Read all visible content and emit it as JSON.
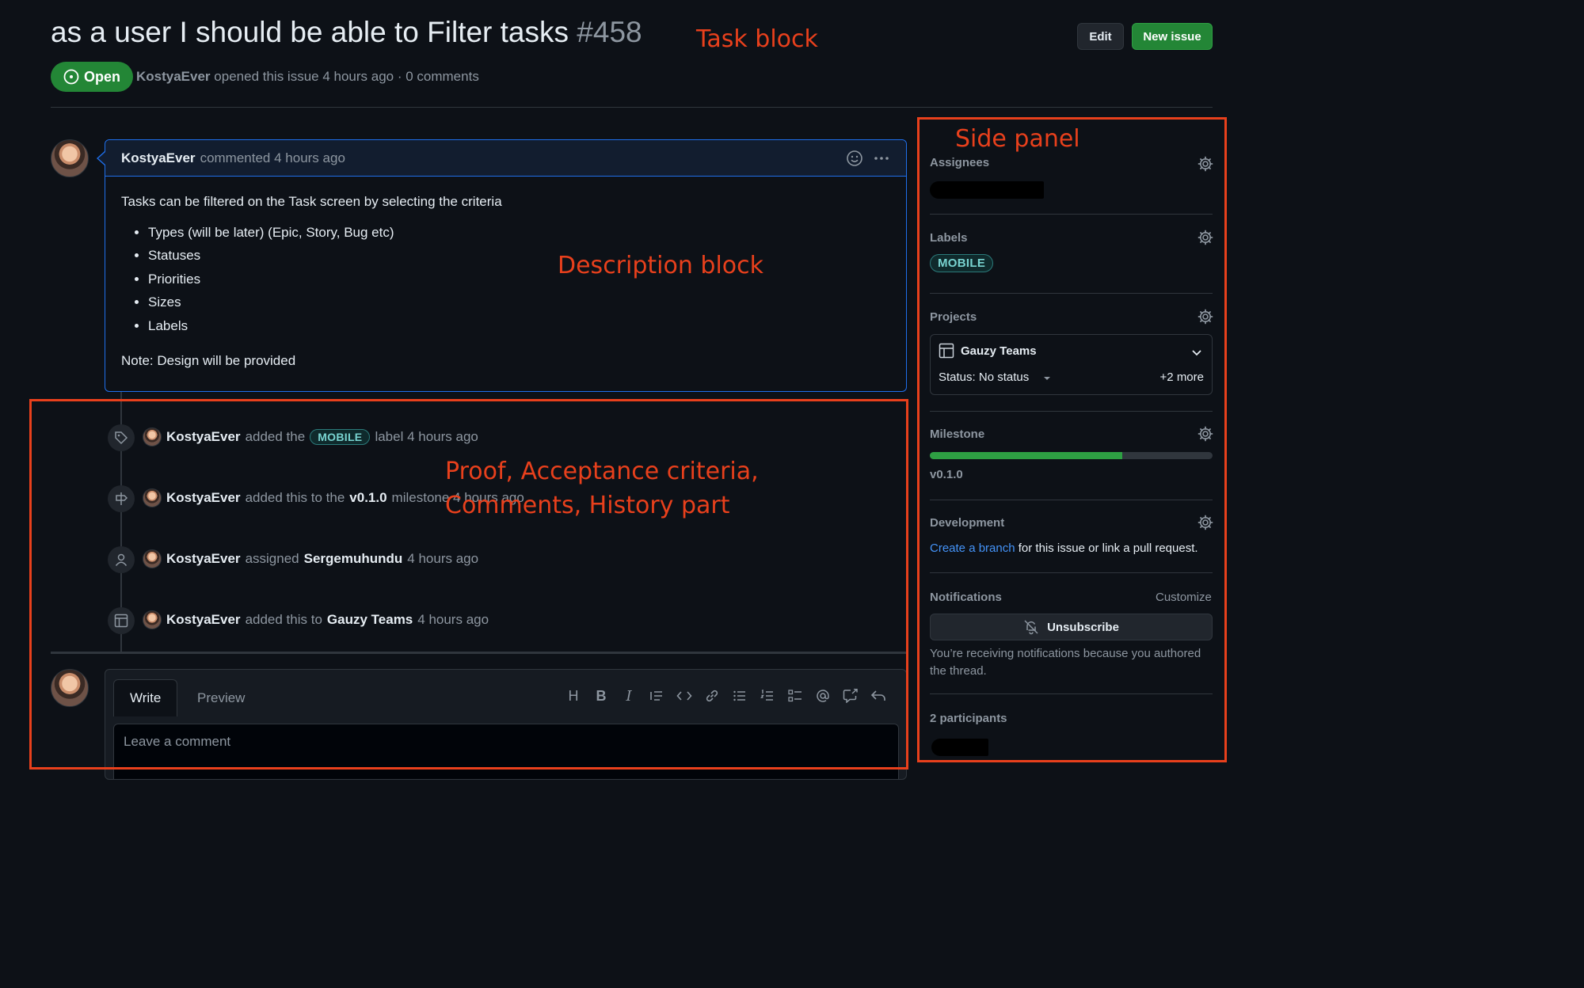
{
  "header": {
    "title": "as a user I should be able to Filter tasks",
    "number": "#458",
    "edit_label": "Edit",
    "new_issue_label": "New issue",
    "state_label": "Open",
    "author": "KostyaEver",
    "meta_text": "opened this issue 4 hours ago · 0 comments"
  },
  "comment": {
    "author": "KostyaEver",
    "time_text": "commented 4 hours ago",
    "intro": "Tasks can be filtered on the Task screen by selecting the criteria",
    "items": [
      "Types (will be later) (Epic, Story, Bug etc)",
      "Statuses",
      "Priorities",
      "Sizes",
      "Labels"
    ],
    "note": "Note: Design will be provided"
  },
  "timeline": [
    {
      "icon": "tag-icon",
      "actor": "KostyaEver",
      "pre": "added the",
      "label": "MOBILE",
      "post": "label 4 hours ago"
    },
    {
      "icon": "milestone-icon",
      "actor": "KostyaEver",
      "pre": "added this to the",
      "bold": "v0.1.0",
      "post": "milestone 4 hours ago"
    },
    {
      "icon": "person-icon",
      "actor": "KostyaEver",
      "pre": "assigned",
      "bold": "Sergemuhundu",
      "post": "4 hours ago"
    },
    {
      "icon": "table-icon",
      "actor": "KostyaEver",
      "pre": "added this to",
      "bold": "Gauzy Teams",
      "post": "4 hours ago"
    }
  ],
  "form": {
    "write_tab": "Write",
    "preview_tab": "Preview",
    "placeholder": "Leave a comment",
    "toolbar_icons": [
      "heading-icon",
      "bold-icon",
      "italic-icon",
      "quote-icon",
      "code-icon",
      "link-icon",
      "bulleted-list-icon",
      "numbered-list-icon",
      "task-list-icon",
      "mention-icon",
      "cross-reference-icon",
      "saved-reply-icon"
    ]
  },
  "sidebar": {
    "assignees_heading": "Assignees",
    "labels_heading": "Labels",
    "label": "MOBILE",
    "projects_heading": "Projects",
    "project_name": "Gauzy Teams",
    "project_status": "Status: No status",
    "project_more": "+2 more",
    "milestone_heading": "Milestone",
    "milestone_progress": 0.68,
    "milestone_name": "v0.1.0",
    "development_heading": "Development",
    "development_link": "Create a branch",
    "development_text": "for this issue or link a pull request.",
    "notifications_heading": "Notifications",
    "customize_label": "Customize",
    "unsubscribe_label": "Unsubscribe",
    "notification_reason": "You’re receiving notifications because you authored the thread.",
    "participants_heading": "2 participants"
  },
  "annotations": {
    "task_block": "Task block",
    "side_panel": "Side panel",
    "description_block": "Description block",
    "history_line1": "Proof, Acceptance criteria,",
    "history_line2": "Comments, History part"
  },
  "colors": {
    "background": "#0d1117",
    "open_green": "#238636",
    "accent_blue": "#1f6feb",
    "annotation_red": "#e8401c",
    "label_teal": "#79d4d1"
  }
}
